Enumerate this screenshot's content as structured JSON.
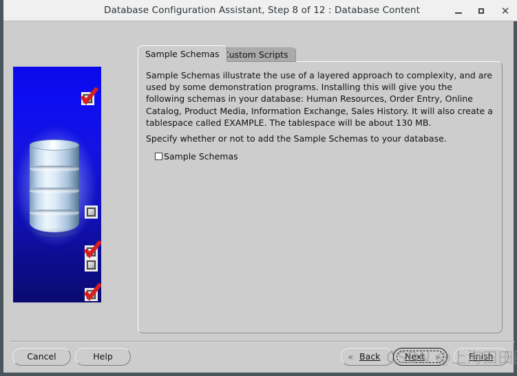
{
  "window": {
    "title": "Database Configuration Assistant, Step 8 of 12 : Database Content",
    "minimize_label": "–",
    "maximize_label": "□",
    "close_label": "✕"
  },
  "tabs": [
    {
      "label": "Sample Schemas",
      "active": true
    },
    {
      "label": "Custom Scripts",
      "active": false
    }
  ],
  "content": {
    "paragraph_main": "Sample Schemas illustrate the use of a layered approach to complexity, and are used by some demonstration programs. Installing this will give you the following schemas in your database: Human Resources, Order Entry, Online Catalog, Product Media, Information Exchange, Sales History. It will also create a tablespace called EXAMPLE. The tablespace will be about 130 MB.",
    "paragraph_specify": "Specify whether or not to add the Sample Schemas to your database.",
    "checkbox": {
      "label": "Sample Schemas",
      "checked": false
    }
  },
  "side_art": {
    "background_top_color": "#0d0df2",
    "background_bottom_color": "#0a0a70",
    "cylinder_color": "#c3d8ec",
    "check_color": "#d42020",
    "icons": [
      {
        "name": "checkbox-checked-1",
        "checked": true
      },
      {
        "name": "checkbox-unchecked-2",
        "checked": false
      },
      {
        "name": "checkbox-checked-3",
        "checked": true
      },
      {
        "name": "checkbox-checked-4",
        "checked": true
      },
      {
        "name": "checkbox-unchecked-5",
        "checked": false
      }
    ]
  },
  "footer": {
    "cancel_label": "Cancel",
    "help_label": "Help",
    "back_label": "Back",
    "back_icon": "«",
    "next_label": "Next",
    "next_icon": "»",
    "finish_label": "Finish"
  },
  "watermark": {
    "text": "CSDN @上海田田圈"
  }
}
